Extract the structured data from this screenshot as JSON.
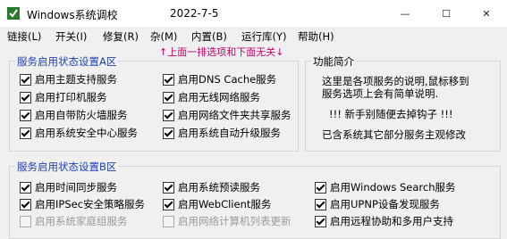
{
  "window": {
    "title": "Windows系统调校",
    "date": "2022-7-5",
    "minimize": "—",
    "maximize": "☐",
    "close": "✕"
  },
  "menu": [
    "链接(L)",
    "开关(I)",
    "修复(R)",
    "杂(M)",
    "内置(B)",
    "运行库(Y)",
    "帮助(H)"
  ],
  "hint": "↑上面一排选项和下面无关↓",
  "groupA": {
    "title": "服务启用状态设置A区",
    "items": [
      {
        "label": "启用主题支持服务",
        "checked": true
      },
      {
        "label": "启用DNS Cache服务",
        "checked": true
      },
      {
        "label": "启用打印机服务",
        "checked": true
      },
      {
        "label": "启用无线网络服务",
        "checked": true
      },
      {
        "label": "启用自带防火墙服务",
        "checked": true
      },
      {
        "label": "启用网络文件夹共享服务",
        "checked": true
      },
      {
        "label": "启用系统安全中心服务",
        "checked": true
      },
      {
        "label": "启用系统自动升级服务",
        "checked": true
      }
    ]
  },
  "functionInfo": {
    "title": "功能简介",
    "line1": "这里是各项服务的说明,鼠标移到",
    "line2": "服务选项上会有简单说明.",
    "line3": "!!! 新手别随便去掉钩子 !!!",
    "line4": "已含系统其它部分服务主观修改"
  },
  "groupB": {
    "title": "服务启用状态设置B区",
    "items": [
      {
        "label": "启用时间同步服务",
        "checked": true,
        "disabled": false
      },
      {
        "label": "启用系统预读服务",
        "checked": true,
        "disabled": false
      },
      {
        "label": "启用Windows Search服务",
        "checked": true,
        "disabled": false
      },
      {
        "label": "启用IPSec安全策略服务",
        "checked": true,
        "disabled": false
      },
      {
        "label": "启用WebClient服务",
        "checked": true,
        "disabled": false
      },
      {
        "label": "启用UPNP设备发现服务",
        "checked": true,
        "disabled": false
      },
      {
        "label": "启用系统家庭组服务",
        "checked": false,
        "disabled": true
      },
      {
        "label": "启用网络计算机列表更新",
        "checked": false,
        "disabled": true
      },
      {
        "label": "启用远程协助和多用户支持",
        "checked": true,
        "disabled": false
      }
    ]
  }
}
